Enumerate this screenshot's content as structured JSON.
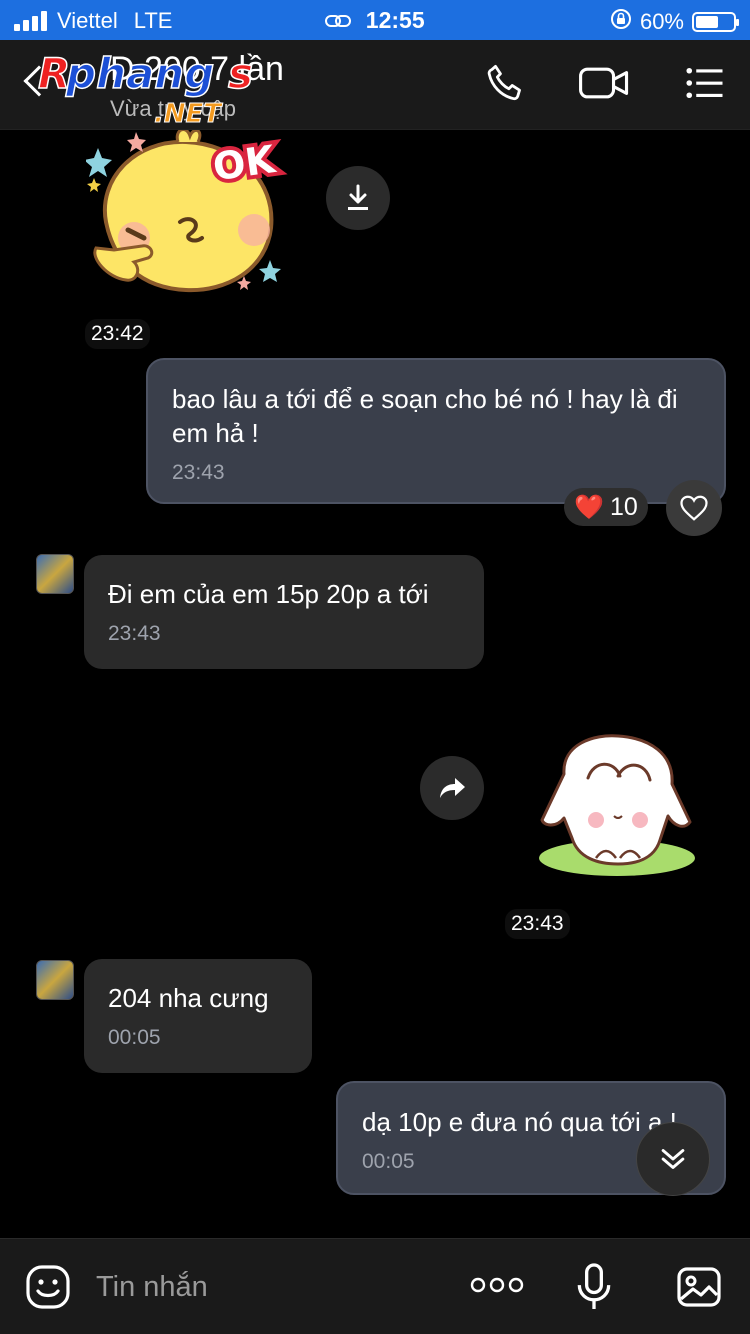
{
  "status_bar": {
    "carrier": "Viettel",
    "network": "LTE",
    "time": "12:55",
    "battery": "60%",
    "battery_level": 0.6
  },
  "header": {
    "title": "Đ    200 7 lần",
    "subtitle": "Vừa      truy cập",
    "watermark": "Rphangs .NET"
  },
  "messages": [
    {
      "type": "sticker",
      "direction": "in",
      "sticker": "ok-chick-sticker",
      "time": "23:42"
    },
    {
      "type": "text",
      "direction": "out",
      "text": "bao lâu a tới để e soạn cho bé nó ! hay là đi em hả !",
      "time": "23:43",
      "reaction": {
        "emoji": "❤️",
        "count": "10"
      }
    },
    {
      "type": "text",
      "direction": "in",
      "text": "Đi em của em 15p 20p a tới",
      "time": "23:43"
    },
    {
      "type": "sticker",
      "direction": "out",
      "sticker": "bunny-sticker",
      "time": "23:43"
    },
    {
      "type": "text",
      "direction": "in",
      "text": "204 nha cưng",
      "time": "00:05"
    },
    {
      "type": "text",
      "direction": "out",
      "text": "dạ 10p e đưa nó qua tới a !",
      "time": "00:05"
    }
  ],
  "input": {
    "placeholder": "Tin nhắn"
  },
  "colors": {
    "status_bar": "#1d6fe0",
    "header": "#1a1a1a",
    "bubble_in": "#2a2a2a",
    "bubble_out": "#3a3f4b",
    "background": "#000000"
  },
  "icons": [
    "back-icon",
    "phone-icon",
    "video-icon",
    "menu-icon",
    "download-icon",
    "share-icon",
    "heart-icon",
    "chevron-down-icon",
    "emoji-icon",
    "more-icon",
    "microphone-icon",
    "image-icon"
  ]
}
